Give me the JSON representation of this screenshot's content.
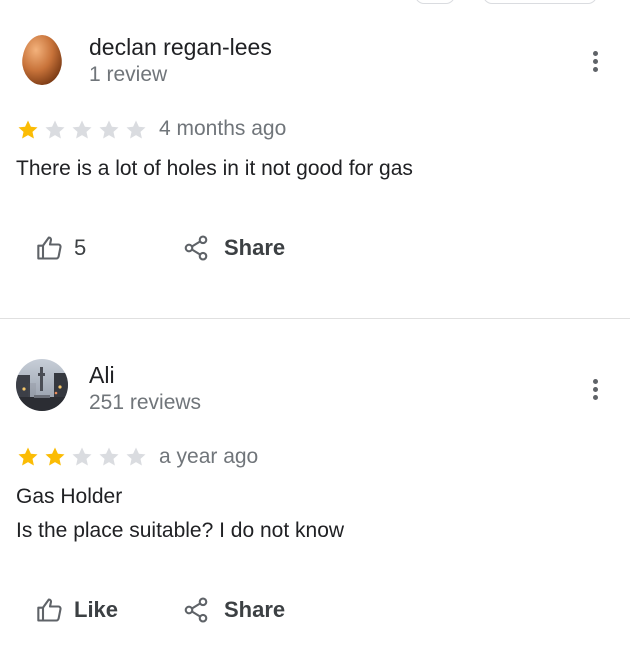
{
  "reviews": [
    {
      "author": "declan regan-lees",
      "review_count": "1 review",
      "rating": 1,
      "max_rating": 5,
      "time": "4 months ago",
      "text_lines": [
        "There is a lot of holes in it not good for gas"
      ],
      "like_label": "5",
      "share_label": "Share",
      "avatar_icon": "egg-avatar"
    },
    {
      "author": "Ali",
      "review_count": "251 reviews",
      "rating": 2,
      "max_rating": 5,
      "time": "a year ago",
      "text_lines": [
        "Gas Holder",
        "Is the place suitable?  I do not know"
      ],
      "like_label": "Like",
      "share_label": "Share",
      "avatar_icon": "city-street-avatar"
    }
  ],
  "colors": {
    "star_filled": "#fbbc04",
    "star_empty": "#dadce0",
    "secondary_text": "#70757a",
    "icon": "#5f6368"
  }
}
